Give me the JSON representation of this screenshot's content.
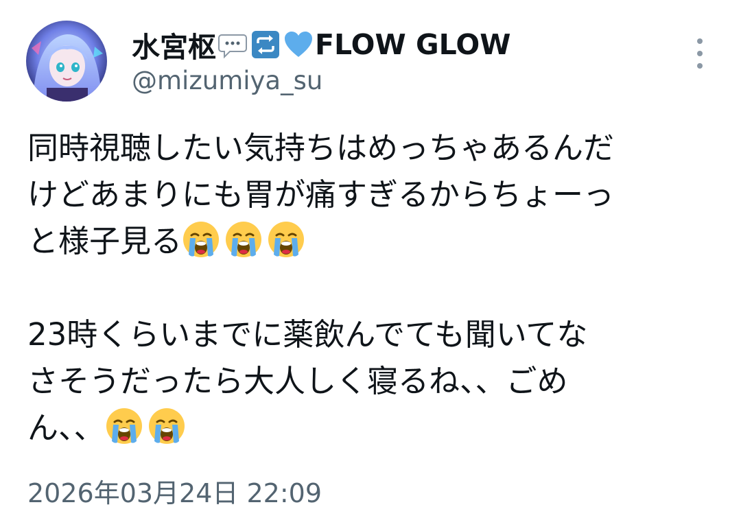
{
  "author": {
    "display_name_prefix": "水宮枢",
    "display_name_emojis": [
      "speech-bubble-icon",
      "repeat-icon",
      "blue-heart-icon"
    ],
    "display_name_suffix": "FLOW GLOW",
    "handle": "@mizumiya_su"
  },
  "tweet": {
    "paragraph1": {
      "line1": "同時視聴したい気持ちはめっちゃあるんだ",
      "line2": "けどあまりにも胃が痛すぎるからちょーっ",
      "line3": "と様子見る"
    },
    "paragraph2": {
      "line1": "23時くらいまでに薬飲んでても聞いてな",
      "line2": "さそうだったら大人しく寝るね、、ごめ",
      "line3": "ん、、"
    },
    "timestamp": "2026年03月24日 22:09"
  },
  "icons": {
    "avatar": "avatar",
    "more": "more-vertical-icon",
    "loudly_crying": "loudly-crying-face-icon"
  },
  "colors": {
    "text": "#0f1419",
    "secondary_text": "#536471",
    "icon_gray": "#8b98a5",
    "repeat_icon_bg": "#3b88c3",
    "heart_blue": "#5dadec"
  }
}
